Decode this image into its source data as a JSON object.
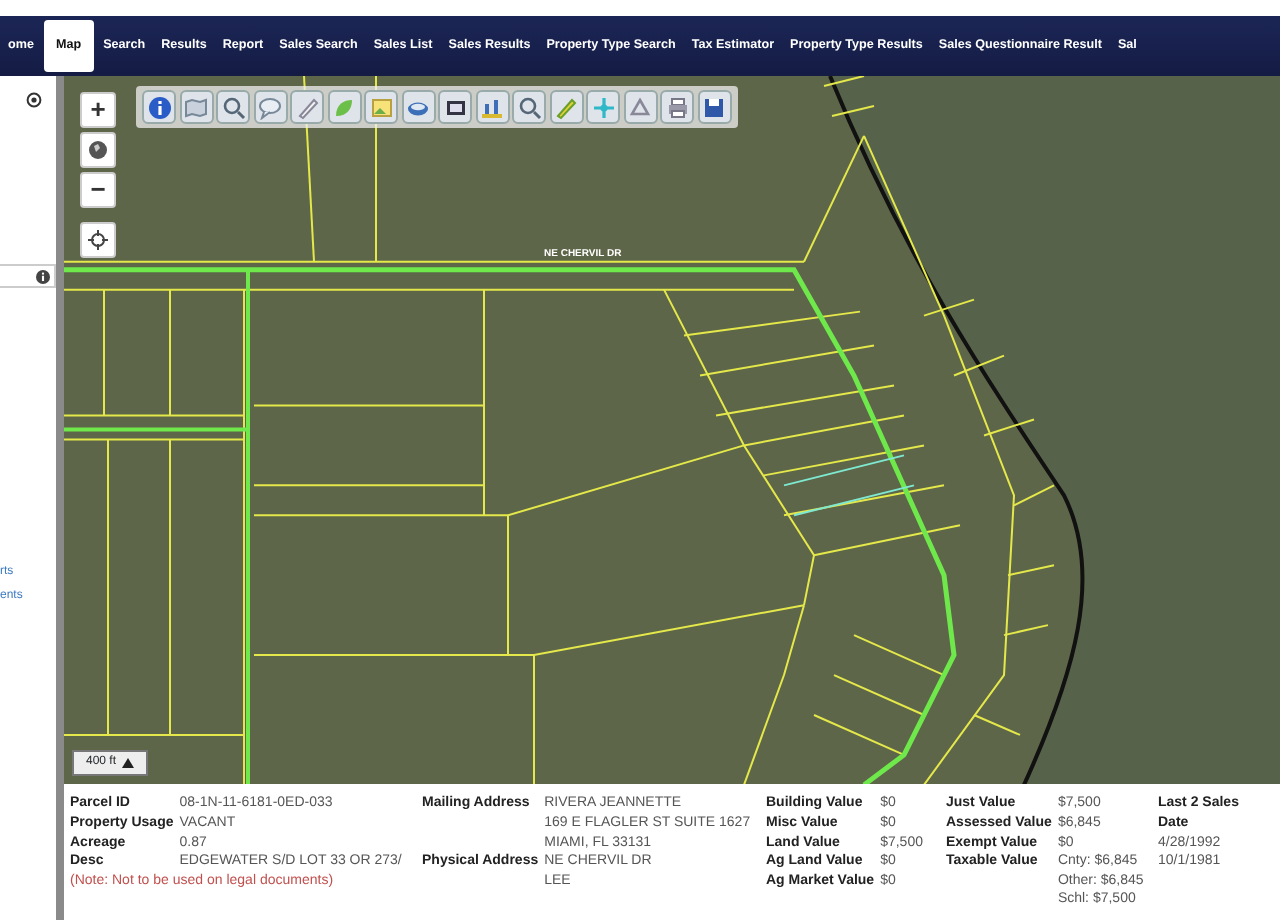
{
  "nav": [
    {
      "label": "ome",
      "selected": false
    },
    {
      "label": "Map",
      "selected": true
    },
    {
      "label": "Search",
      "selected": false
    },
    {
      "label": "Results",
      "selected": false
    },
    {
      "label": "Report",
      "selected": false
    },
    {
      "label": "Sales Search",
      "selected": false
    },
    {
      "label": "Sales List",
      "selected": false
    },
    {
      "label": "Sales Results",
      "selected": false
    },
    {
      "label": "Property Type Search",
      "selected": false
    },
    {
      "label": "Tax Estimator",
      "selected": false
    },
    {
      "label": "Property Type Results",
      "selected": false
    },
    {
      "label": "Sales Questionnaire Result",
      "selected": false
    },
    {
      "label": "Sal",
      "selected": false
    }
  ],
  "sidebar": {
    "links": [
      "rts",
      "ents"
    ]
  },
  "map": {
    "zoom_in": "+",
    "zoom_out": "−",
    "street_label": "NE CHERVIL DR",
    "scale": "400 ft"
  },
  "parcel": {
    "columns": [
      {
        "rows": [
          {
            "label": "Parcel ID",
            "values": [
              "08-1N-11-6181-0ED-033"
            ]
          },
          {
            "label": "Property Usage",
            "values": [
              "VACANT"
            ]
          },
          {
            "label": "Acreage",
            "values": [
              "0.87"
            ]
          },
          {
            "label": "Desc",
            "values": [
              "EDGEWATER S/D LOT 33 OR 273/"
            ]
          }
        ],
        "note": "(Note: Not to be used on legal documents)"
      },
      {
        "rows": [
          {
            "label": "Mailing Address",
            "values": [
              "RIVERA JEANNETTE",
              "169 E FLAGLER ST SUITE 1627",
              "MIAMI, FL 33131"
            ]
          },
          {
            "label": "Physical Address",
            "values": [
              "NE CHERVIL DR",
              "LEE"
            ]
          }
        ]
      },
      {
        "rows": [
          {
            "label": "Building Value",
            "values": [
              "$0"
            ]
          },
          {
            "label": "Misc Value",
            "values": [
              "$0"
            ]
          },
          {
            "label": "Land Value",
            "values": [
              "$7,500"
            ]
          },
          {
            "label": "Ag Land Value",
            "values": [
              "$0"
            ]
          },
          {
            "label": "Ag Market Value",
            "values": [
              "$0"
            ]
          }
        ]
      },
      {
        "rows": [
          {
            "label": "Just Value",
            "values": [
              "$7,500"
            ]
          },
          {
            "label": "Assessed Value",
            "values": [
              "$6,845"
            ]
          },
          {
            "label": "Exempt Value",
            "values": [
              "$0"
            ]
          },
          {
            "label": "Taxable Value",
            "values": [
              "Cnty: $6,845",
              "Other: $6,845",
              "Schl: $7,500"
            ]
          }
        ]
      },
      {
        "rows": [
          {
            "label": "Last 2 Sales"
          },
          {
            "label": "Date"
          },
          {
            "values": [
              "4/28/1992"
            ]
          },
          {
            "values": [
              "10/1/1981"
            ]
          }
        ]
      }
    ]
  }
}
